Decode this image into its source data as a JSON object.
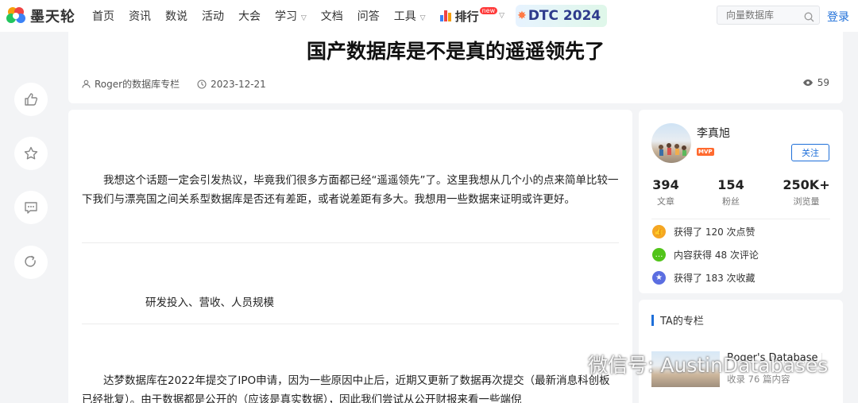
{
  "nav": {
    "logo_text": "墨天轮",
    "items": [
      {
        "label": "首页",
        "has_menu": false
      },
      {
        "label": "资讯",
        "has_menu": false
      },
      {
        "label": "数说",
        "has_menu": false
      },
      {
        "label": "活动",
        "has_menu": false
      },
      {
        "label": "大会",
        "has_menu": false
      },
      {
        "label": "学习",
        "has_menu": true
      },
      {
        "label": "文档",
        "has_menu": false
      },
      {
        "label": "问答",
        "has_menu": false
      },
      {
        "label": "工具",
        "has_menu": true
      }
    ],
    "rank_label": "排行",
    "new_badge": "new",
    "dtc_label": "DTC 2024",
    "search_placeholder": "向量数据库",
    "login_label": "登录"
  },
  "article": {
    "title": "国产数据库是不是真的遥遥领先了",
    "author": "Roger的数据库专栏",
    "date": "2023-12-21",
    "views": "59",
    "paragraph1": "我想这个话题一定会引发热议，毕竟我们很多方面都已经“遥遥领先”了。这里我想从几个小的点来简单比较一下我们与漂亮国之间关系型数据库是否还有差距，或者说差距有多大。我想用一些数据来证明或许更好。",
    "subhead": "研发投入、营收、人员规模",
    "paragraph2": "达梦数据库在2022年提交了IPO申请，因为一些原因中止后，近期又更新了数据再次提交（最新消息科创板已经批复）。由于数据都是公开的（应该是真实数据），因此我们尝试从公开财报来看一些端倪"
  },
  "author_card": {
    "name": "李真旭",
    "badge": "MVP",
    "follow_label": "关注",
    "stats": [
      {
        "num": "394",
        "label": "文章"
      },
      {
        "num": "154",
        "label": "粉丝"
      },
      {
        "num": "250K+",
        "label": "浏览量"
      }
    ],
    "achievements": [
      {
        "text": "获得了 120 次点赞",
        "color": "#f5a623"
      },
      {
        "text": "内容获得 48 次评论",
        "color": "#52c41a"
      },
      {
        "text": "获得了 183 次收藏",
        "color": "#5b6ee1"
      }
    ]
  },
  "column": {
    "title": "TA的专栏",
    "name": "Roger's Database N",
    "stats": "收录 76 篇内容"
  },
  "watermark": "微信号: AustinDatabases"
}
